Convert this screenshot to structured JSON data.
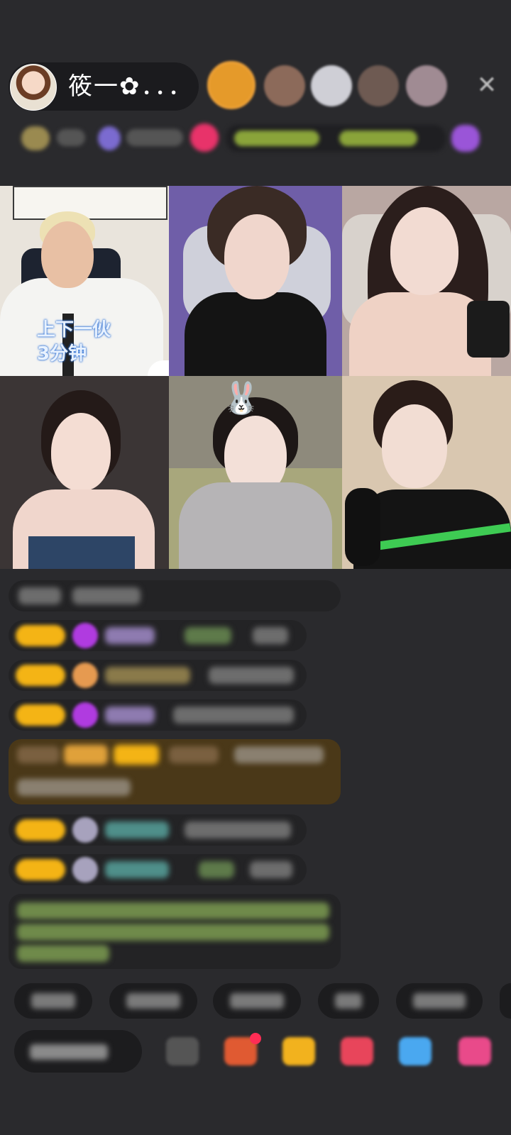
{
  "header": {
    "host_name": "筱一✿．．．",
    "close_icon": "close-icon"
  },
  "grid": {
    "tile1_caption_line1": "上下一伙",
    "tile1_caption_line2": "3分钟",
    "tile5_overlay_icon": "bunny-icon"
  },
  "bottom_bar": {
    "icons": [
      "emoji-icon",
      "gift-box-icon",
      "treasure-icon",
      "heart-icon",
      "message-icon",
      "gift-icon"
    ]
  },
  "colors": {
    "background": "#2a2a2d",
    "level_badge": "#f4b415",
    "chat_bubble": "#232325",
    "highlight_bubble": "#4a3818"
  }
}
